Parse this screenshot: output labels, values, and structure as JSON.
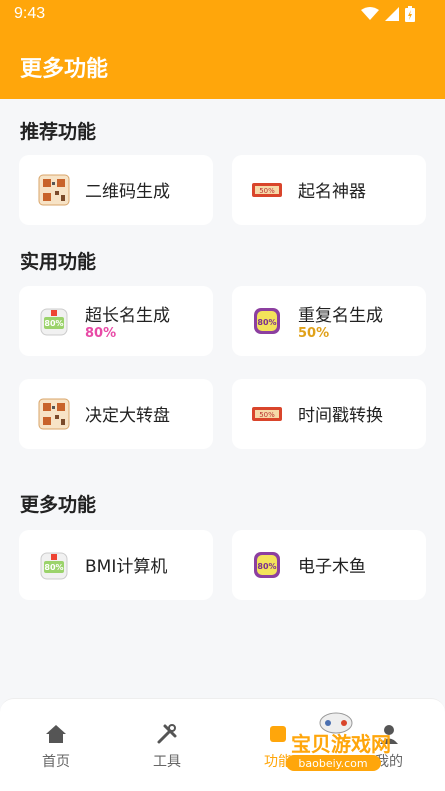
{
  "status": {
    "time": "9:43"
  },
  "header": {
    "title": "更多功能"
  },
  "sections": [
    {
      "title": "推荐功能"
    },
    {
      "title": "实用功能"
    },
    {
      "title": "更多功能"
    }
  ],
  "cards": {
    "qr": {
      "label": "二维码生成",
      "icon": "qr-code-icon"
    },
    "naming": {
      "label": "起名神器",
      "icon": "name-tag-icon"
    },
    "long_name": {
      "label": "超长名生成",
      "percent": "80%",
      "icon": "badge-80-icon"
    },
    "repeat_name": {
      "label": "重复名生成",
      "percent": "50%",
      "icon": "badge-80-icon"
    },
    "wheel": {
      "label": "决定大转盘",
      "icon": "qr-code-icon"
    },
    "timestamp": {
      "label": "时间戳转换",
      "icon": "name-tag-icon"
    },
    "bmi": {
      "label": "BMI计算机",
      "icon": "badge-80-icon"
    },
    "fish": {
      "label": "电子木鱼",
      "icon": "badge-80-icon"
    }
  },
  "colors": {
    "accent": "#ffa60b",
    "pink": "#e84aa6",
    "gold": "#e0a11a"
  },
  "tabs": [
    {
      "label": "首页",
      "icon": "home-icon"
    },
    {
      "label": "工具",
      "icon": "tools-icon"
    },
    {
      "label": "功能",
      "icon": "function-icon"
    },
    {
      "label": "我的",
      "icon": "profile-icon"
    }
  ],
  "watermark": {
    "title": "宝贝游戏网",
    "url": "baobeiy.com"
  }
}
